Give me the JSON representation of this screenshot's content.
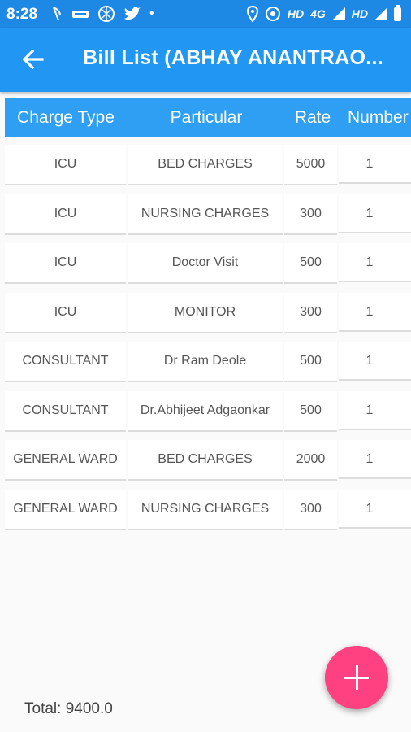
{
  "status_bar": {
    "time": "8:28",
    "hd1": "HD",
    "network": "4G",
    "hd2": "HD",
    "icons": [
      "moon-icon",
      "app-icon",
      "shutter-icon",
      "twitter-icon",
      "dot-icon",
      "location-icon",
      "hotspot-icon",
      "signal-icon",
      "battery-icon"
    ]
  },
  "app_bar": {
    "title": "Bill List (ABHAY  ANANTRAO...",
    "back_icon": "arrow-left-icon",
    "color": "#2196f3"
  },
  "table": {
    "headers": [
      "Charge Type",
      "Particular",
      "Rate",
      "Number"
    ],
    "rows": [
      [
        "ICU",
        "BED CHARGES",
        "5000",
        "1"
      ],
      [
        "ICU",
        "NURSING CHARGES",
        "300",
        "1"
      ],
      [
        "ICU",
        "Doctor Visit",
        "500",
        "1"
      ],
      [
        "ICU",
        "MONITOR",
        "300",
        "1"
      ],
      [
        "CONSULTANT",
        "Dr Ram Deole",
        "500",
        "1"
      ],
      [
        "CONSULTANT",
        "Dr.Abhijeet Adgaonkar",
        "500",
        "1"
      ],
      [
        "GENERAL WARD",
        "BED CHARGES",
        "2000",
        "1"
      ],
      [
        "GENERAL WARD",
        "NURSING CHARGES",
        "300",
        "1"
      ]
    ]
  },
  "total": "Total: 9400.0",
  "fab": {
    "icon": "plus-icon",
    "color": "#ff4081"
  }
}
